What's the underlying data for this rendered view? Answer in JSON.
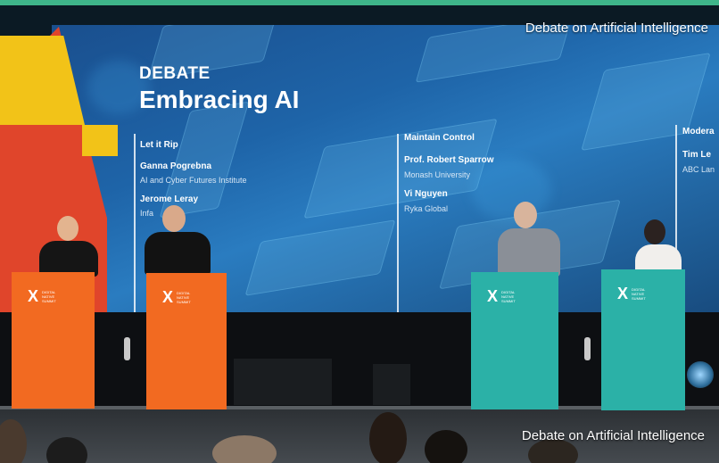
{
  "captions": {
    "top": "Debate on Artificial Intelligence",
    "bottom": "Debate on Artificial Intelligence"
  },
  "slide": {
    "label": "DEBATE",
    "title": "Embracing AI",
    "columns": [
      {
        "heading": "Let it Rip",
        "people": [
          {
            "name": "Ganna Pogrebna",
            "org": "AI and Cyber Futures Institute"
          },
          {
            "name": "Jerome Leray",
            "org": "Infa"
          }
        ]
      },
      {
        "heading": "Maintain Control",
        "people": [
          {
            "name": "Prof. Robert Sparrow",
            "org": "Monash University"
          },
          {
            "name": "Vi Nguyen",
            "org": "Ryka Global"
          }
        ]
      },
      {
        "heading": "Modera",
        "people": [
          {
            "name": "Tim Le",
            "org": "ABC Lan"
          }
        ]
      }
    ]
  },
  "lecterns": {
    "mark": "X",
    "text": "DIGITAL NATIVE SUMMIT"
  },
  "colors": {
    "orange": "#f26a21",
    "teal": "#2bb1a7",
    "screen_blue": "#1e64a8"
  }
}
